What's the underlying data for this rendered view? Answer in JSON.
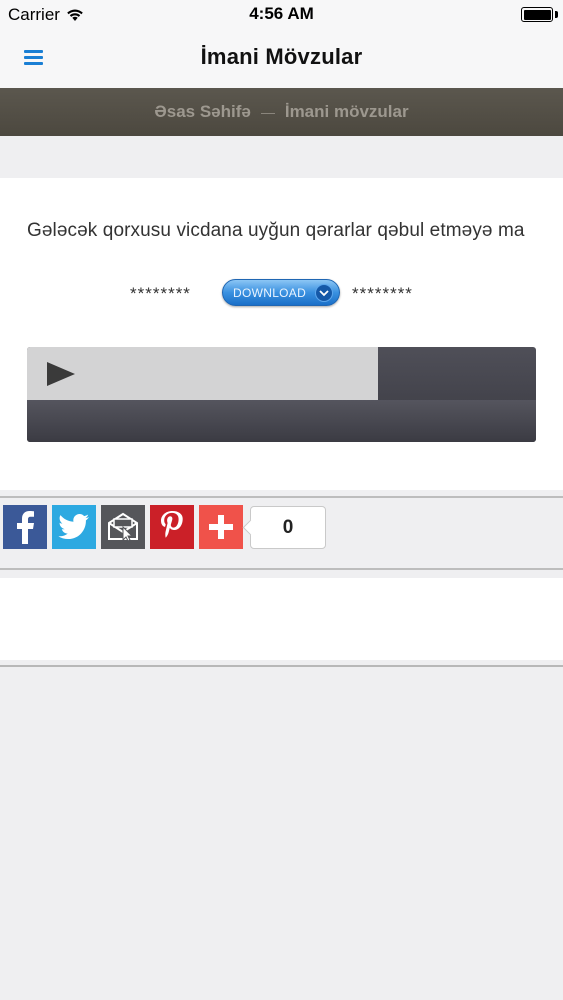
{
  "status_bar": {
    "carrier": "Carrier",
    "time": "4:56 AM"
  },
  "nav": {
    "title": "İmani Mövzular",
    "menu_icon": "hamburger-menu-icon"
  },
  "breadcrumb": {
    "items": [
      "Əsas Səhifə",
      "İmani mövzular"
    ]
  },
  "article": {
    "title": "Gələcək qorxusu vicdana uyğun qərarlar qəbul etməyə ma",
    "stars_left": "********",
    "stars_right": "********",
    "download_label": "DOWNLOAD"
  },
  "player": {
    "progress": 0.69
  },
  "share": {
    "buttons": [
      "facebook-icon",
      "twitter-icon",
      "email-icon",
      "pinterest-icon",
      "plus-icon"
    ],
    "count": "0"
  },
  "colors": {
    "accent": "#1a7fd4",
    "breadcrumb_bg": "#514d44",
    "facebook": "#3b5998",
    "twitter": "#2da9e1",
    "email": "#55565a",
    "pinterest": "#cb2028",
    "plus": "#f0524a"
  }
}
